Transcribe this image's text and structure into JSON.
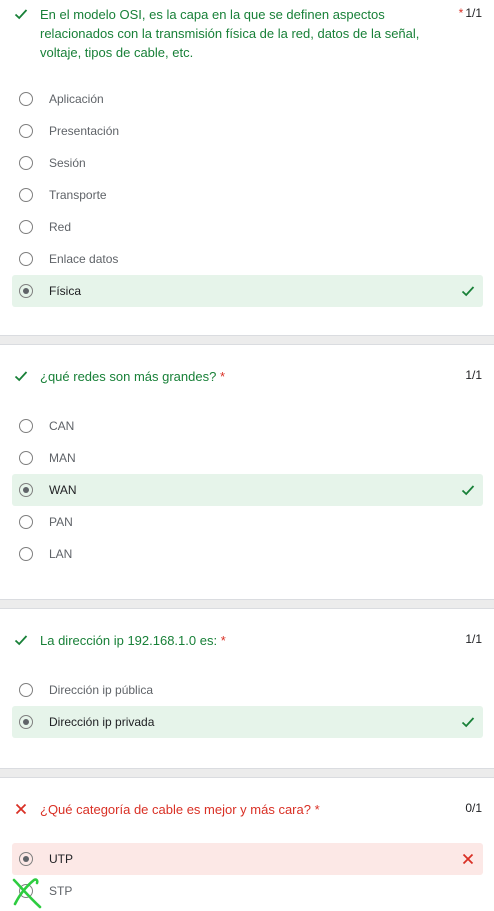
{
  "colors": {
    "correct": "#188038",
    "incorrect": "#d93025",
    "correct_bg": "#e6f4ea",
    "incorrect_bg": "#fce8e6"
  },
  "questions": [
    {
      "status": "correct",
      "title": "En el modelo OSI, es la capa en la que se definen aspectos relacionados con la transmisión física de la red, datos de la señal, voltaje, tipos de cable, etc.",
      "required": "*",
      "score": "1/1",
      "options": [
        "Aplicación",
        "Presentación",
        "Sesión",
        "Transporte",
        "Red",
        "Enlace datos",
        "Física"
      ],
      "selected": "Física"
    },
    {
      "status": "correct",
      "title": "¿qué redes son más grandes?",
      "required": "*",
      "score": "1/1",
      "options": [
        "CAN",
        "MAN",
        "WAN",
        "PAN",
        "LAN"
      ],
      "selected": "WAN"
    },
    {
      "status": "correct",
      "title": "La dirección ip 192.168.1.0 es:",
      "required": "*",
      "score": "1/1",
      "options": [
        "Dirección ip pública",
        "Dirección ip privada"
      ],
      "selected": "Dirección ip privada"
    },
    {
      "status": "incorrect",
      "title": "¿Qué categoría de cable es mejor y más cara?",
      "required": "*",
      "score": "0/1",
      "options": [
        "UTP",
        "STP"
      ],
      "selected": "UTP"
    }
  ]
}
